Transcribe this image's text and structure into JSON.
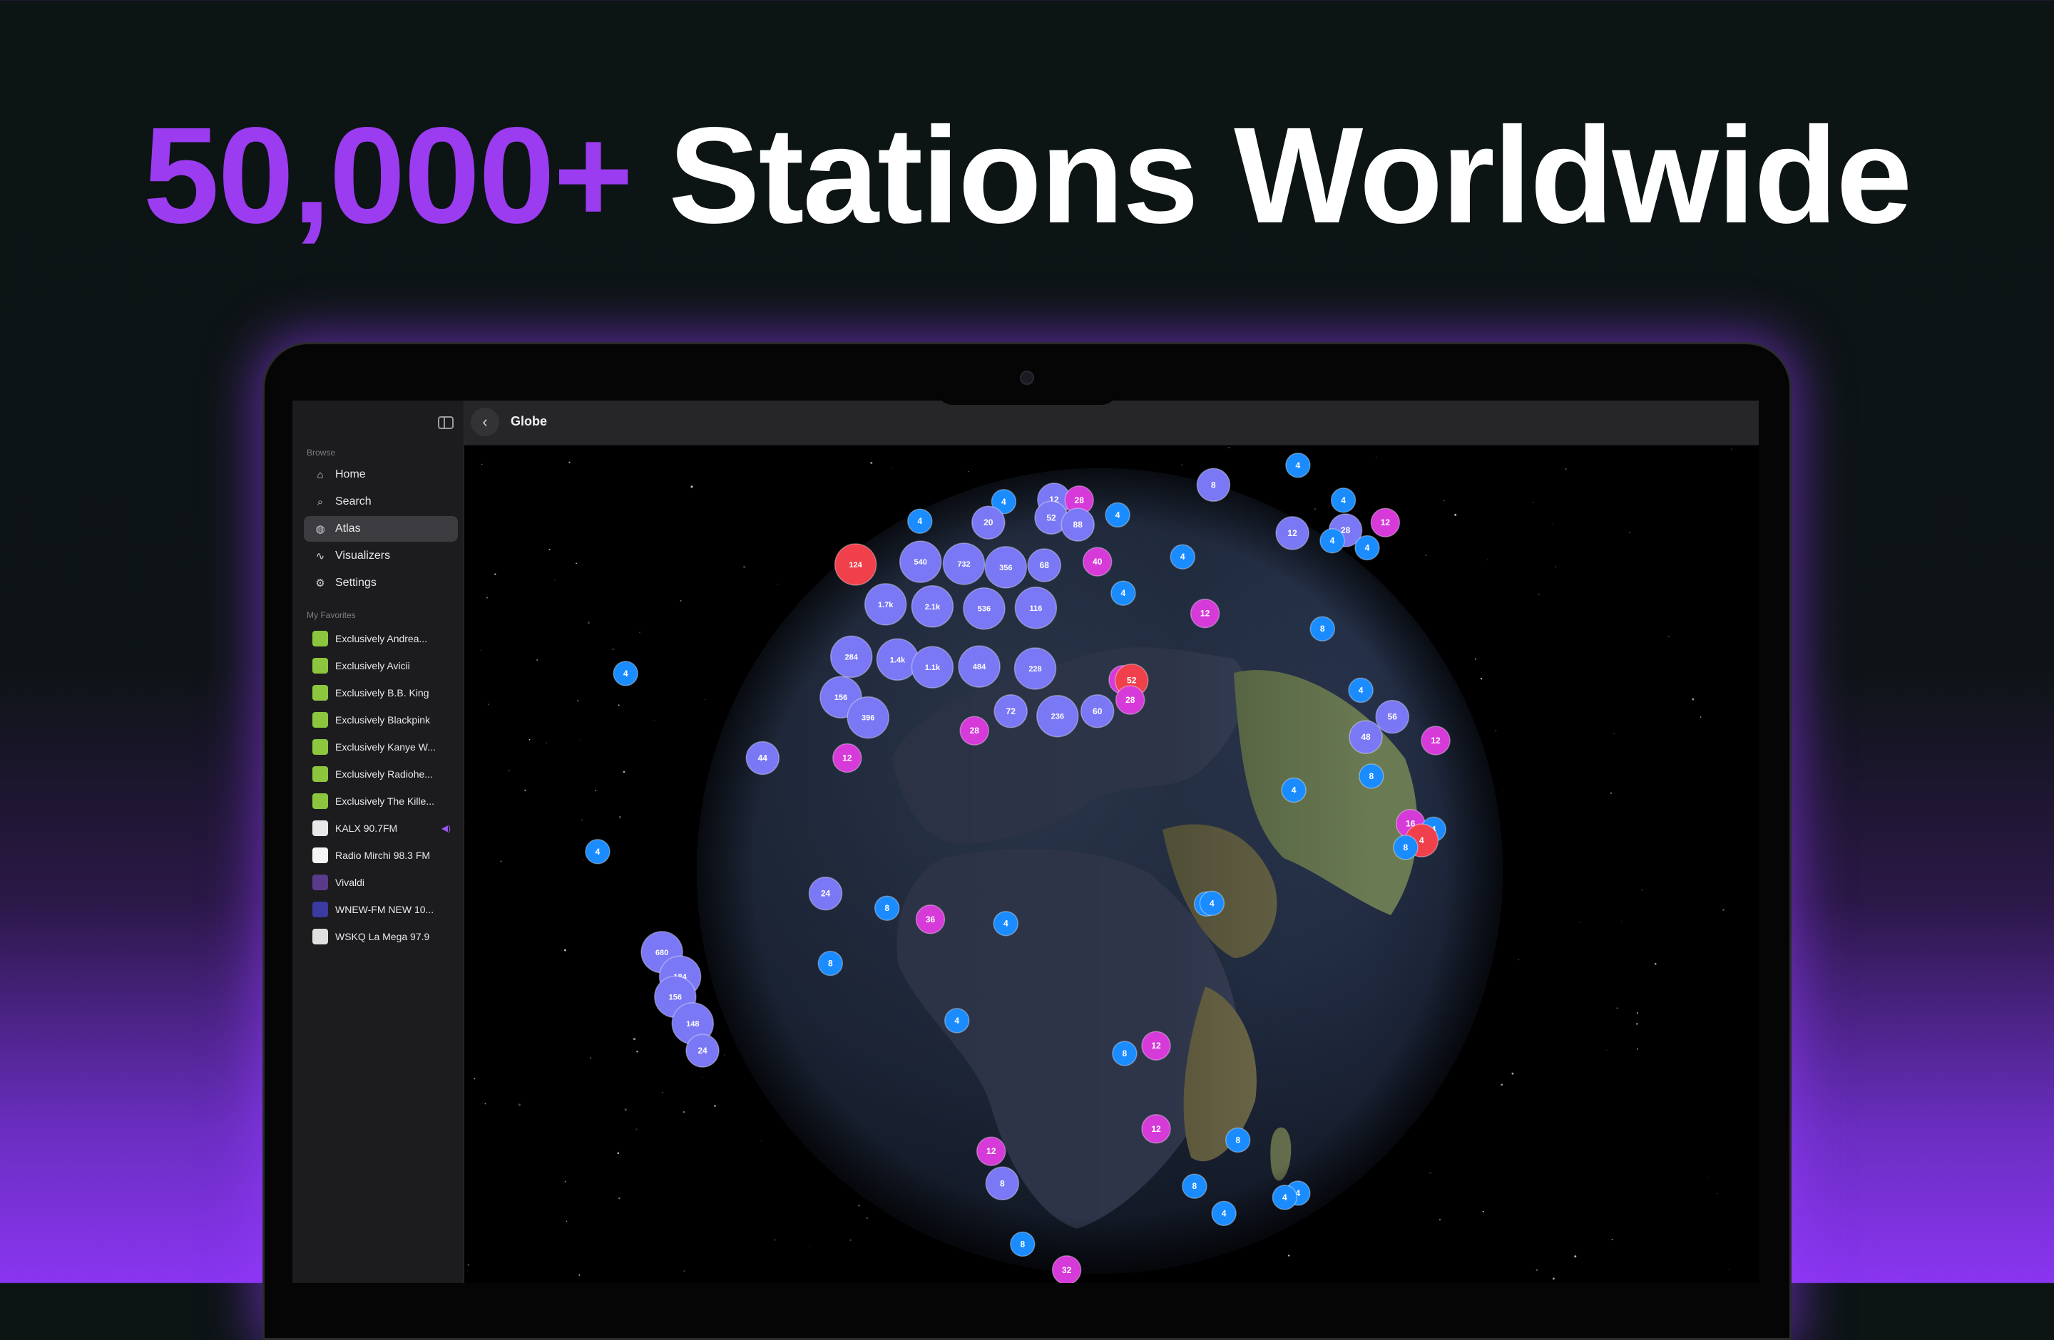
{
  "headline": {
    "accent": "50,000+",
    "rest": "Stations Worldwide",
    "accent_color": "#9b3cf0"
  },
  "app": {
    "sidebar": {
      "browse_label": "Browse",
      "nav": [
        {
          "label": "Home",
          "icon": "house-icon",
          "active": false
        },
        {
          "label": "Search",
          "icon": "magnifier-icon",
          "active": false
        },
        {
          "label": "Atlas",
          "icon": "globe-icon",
          "active": true
        },
        {
          "label": "Visualizers",
          "icon": "waveform-icon",
          "active": false
        },
        {
          "label": "Settings",
          "icon": "gear-icon",
          "active": false
        }
      ],
      "favorites_label": "My Favorites",
      "favorites": [
        {
          "label": "Exclusively Andrea...",
          "art_color": "#8cc63f"
        },
        {
          "label": "Exclusively Avicii",
          "art_color": "#8cc63f"
        },
        {
          "label": "Exclusively B.B. King",
          "art_color": "#8cc63f"
        },
        {
          "label": "Exclusively Blackpink",
          "art_color": "#8cc63f"
        },
        {
          "label": "Exclusively Kanye W...",
          "art_color": "#8cc63f"
        },
        {
          "label": "Exclusively Radiohe...",
          "art_color": "#8cc63f"
        },
        {
          "label": "Exclusively The Kille...",
          "art_color": "#8cc63f"
        },
        {
          "label": "KALX 90.7FM",
          "art_color": "#e8e8e8",
          "playing": true
        },
        {
          "label": "Radio Mirchi 98.3 FM",
          "art_color": "#f4f4f4"
        },
        {
          "label": "Vivaldi",
          "art_color": "#5a3a8a"
        },
        {
          "label": "WNEW-FM NEW 10...",
          "art_color": "#3a3aa0"
        },
        {
          "label": "WSKQ La Mega 97.9",
          "art_color": "#e0e0e0"
        }
      ]
    },
    "topbar": {
      "title": "Globe"
    },
    "colors": {
      "blue": "#1a8cff",
      "indigo": "#7a78f5",
      "magenta": "#d63ad8",
      "red": "#f0404c"
    },
    "clusters": [
      {
        "label": "4",
        "color": "blue"
      },
      {
        "label": "12",
        "color": "indigo"
      },
      {
        "label": "28",
        "color": "magenta"
      },
      {
        "label": "4",
        "color": "blue"
      },
      {
        "label": "8",
        "color": "indigo"
      },
      {
        "label": "4",
        "color": "blue"
      },
      {
        "label": "4",
        "color": "blue"
      },
      {
        "label": "20",
        "color": "indigo"
      },
      {
        "label": "52",
        "color": "indigo"
      },
      {
        "label": "88",
        "color": "indigo"
      },
      {
        "label": "4",
        "color": "blue"
      },
      {
        "label": "12",
        "color": "magenta"
      },
      {
        "label": "28",
        "color": "indigo"
      },
      {
        "label": "12",
        "color": "indigo"
      },
      {
        "label": "4",
        "color": "blue"
      },
      {
        "label": "4",
        "color": "blue"
      },
      {
        "label": "124",
        "color": "red"
      },
      {
        "label": "540",
        "color": "indigo"
      },
      {
        "label": "732",
        "color": "indigo"
      },
      {
        "label": "356",
        "color": "indigo"
      },
      {
        "label": "68",
        "color": "indigo"
      },
      {
        "label": "40",
        "color": "magenta"
      },
      {
        "label": "4",
        "color": "blue"
      },
      {
        "label": "1.7k",
        "color": "indigo"
      },
      {
        "label": "2.1k",
        "color": "indigo"
      },
      {
        "label": "536",
        "color": "indigo"
      },
      {
        "label": "116",
        "color": "indigo"
      },
      {
        "label": "4",
        "color": "blue"
      },
      {
        "label": "12",
        "color": "magenta"
      },
      {
        "label": "8",
        "color": "blue"
      },
      {
        "label": "284",
        "color": "indigo"
      },
      {
        "label": "1.4k",
        "color": "indigo"
      },
      {
        "label": "1.1k",
        "color": "indigo"
      },
      {
        "label": "484",
        "color": "indigo"
      },
      {
        "label": "228",
        "color": "indigo"
      },
      {
        "label": "32",
        "color": "magenta"
      },
      {
        "label": "4",
        "color": "blue"
      },
      {
        "label": "52",
        "color": "red"
      },
      {
        "label": "156",
        "color": "indigo"
      },
      {
        "label": "396",
        "color": "indigo"
      },
      {
        "label": "72",
        "color": "indigo"
      },
      {
        "label": "236",
        "color": "indigo"
      },
      {
        "label": "60",
        "color": "indigo"
      },
      {
        "label": "28",
        "color": "magenta"
      },
      {
        "label": "4",
        "color": "blue"
      },
      {
        "label": "56",
        "color": "indigo"
      },
      {
        "label": "48",
        "color": "indigo"
      },
      {
        "label": "12",
        "color": "magenta"
      },
      {
        "label": "28",
        "color": "magenta"
      },
      {
        "label": "44",
        "color": "indigo"
      },
      {
        "label": "12",
        "color": "magenta"
      },
      {
        "label": "8",
        "color": "blue"
      },
      {
        "label": "4",
        "color": "blue"
      },
      {
        "label": "16",
        "color": "magenta"
      },
      {
        "label": "4",
        "color": "blue"
      },
      {
        "label": "4",
        "color": "red"
      },
      {
        "label": "8",
        "color": "blue"
      },
      {
        "label": "4",
        "color": "blue"
      },
      {
        "label": "24",
        "color": "indigo"
      },
      {
        "label": "8",
        "color": "blue"
      },
      {
        "label": "36",
        "color": "magenta"
      },
      {
        "label": "4",
        "color": "blue"
      },
      {
        "label": "4",
        "color": "blue"
      },
      {
        "label": "4",
        "color": "blue"
      },
      {
        "label": "680",
        "color": "indigo"
      },
      {
        "label": "184",
        "color": "indigo"
      },
      {
        "label": "156",
        "color": "indigo"
      },
      {
        "label": "148",
        "color": "indigo"
      },
      {
        "label": "24",
        "color": "indigo"
      },
      {
        "label": "8",
        "color": "blue"
      },
      {
        "label": "4",
        "color": "blue"
      },
      {
        "label": "8",
        "color": "blue"
      },
      {
        "label": "12",
        "color": "magenta"
      },
      {
        "label": "12",
        "color": "magenta"
      },
      {
        "label": "12",
        "color": "magenta"
      },
      {
        "label": "8",
        "color": "indigo"
      },
      {
        "label": "8",
        "color": "blue"
      },
      {
        "label": "8",
        "color": "blue"
      },
      {
        "label": "4",
        "color": "blue"
      },
      {
        "label": "4",
        "color": "blue"
      },
      {
        "label": "8",
        "color": "blue"
      },
      {
        "label": "32",
        "color": "magenta"
      },
      {
        "label": "4",
        "color": "blue"
      }
    ]
  }
}
